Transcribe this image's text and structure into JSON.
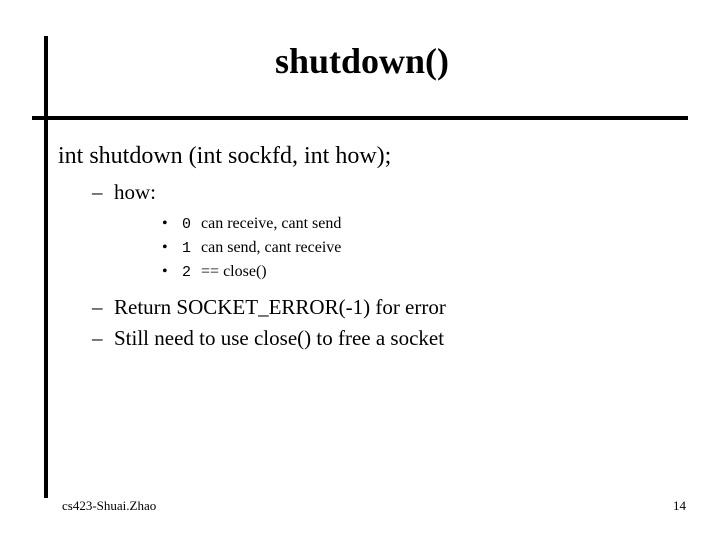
{
  "title": "shutdown()",
  "signature": "int shutdown (int sockfd, int how);",
  "sub1_a": "how:",
  "opts": [
    {
      "num": "0",
      "desc": "can receive, cant send"
    },
    {
      "num": "1",
      "desc": "can send, cant receive"
    },
    {
      "num": "2",
      "desc": "== close()"
    }
  ],
  "sub1_b": "Return SOCKET_ERROR(-1) for error",
  "sub1_c": "Still need to use close() to free a socket",
  "footer_left": "cs423-Shuai.Zhao",
  "footer_right": "14"
}
